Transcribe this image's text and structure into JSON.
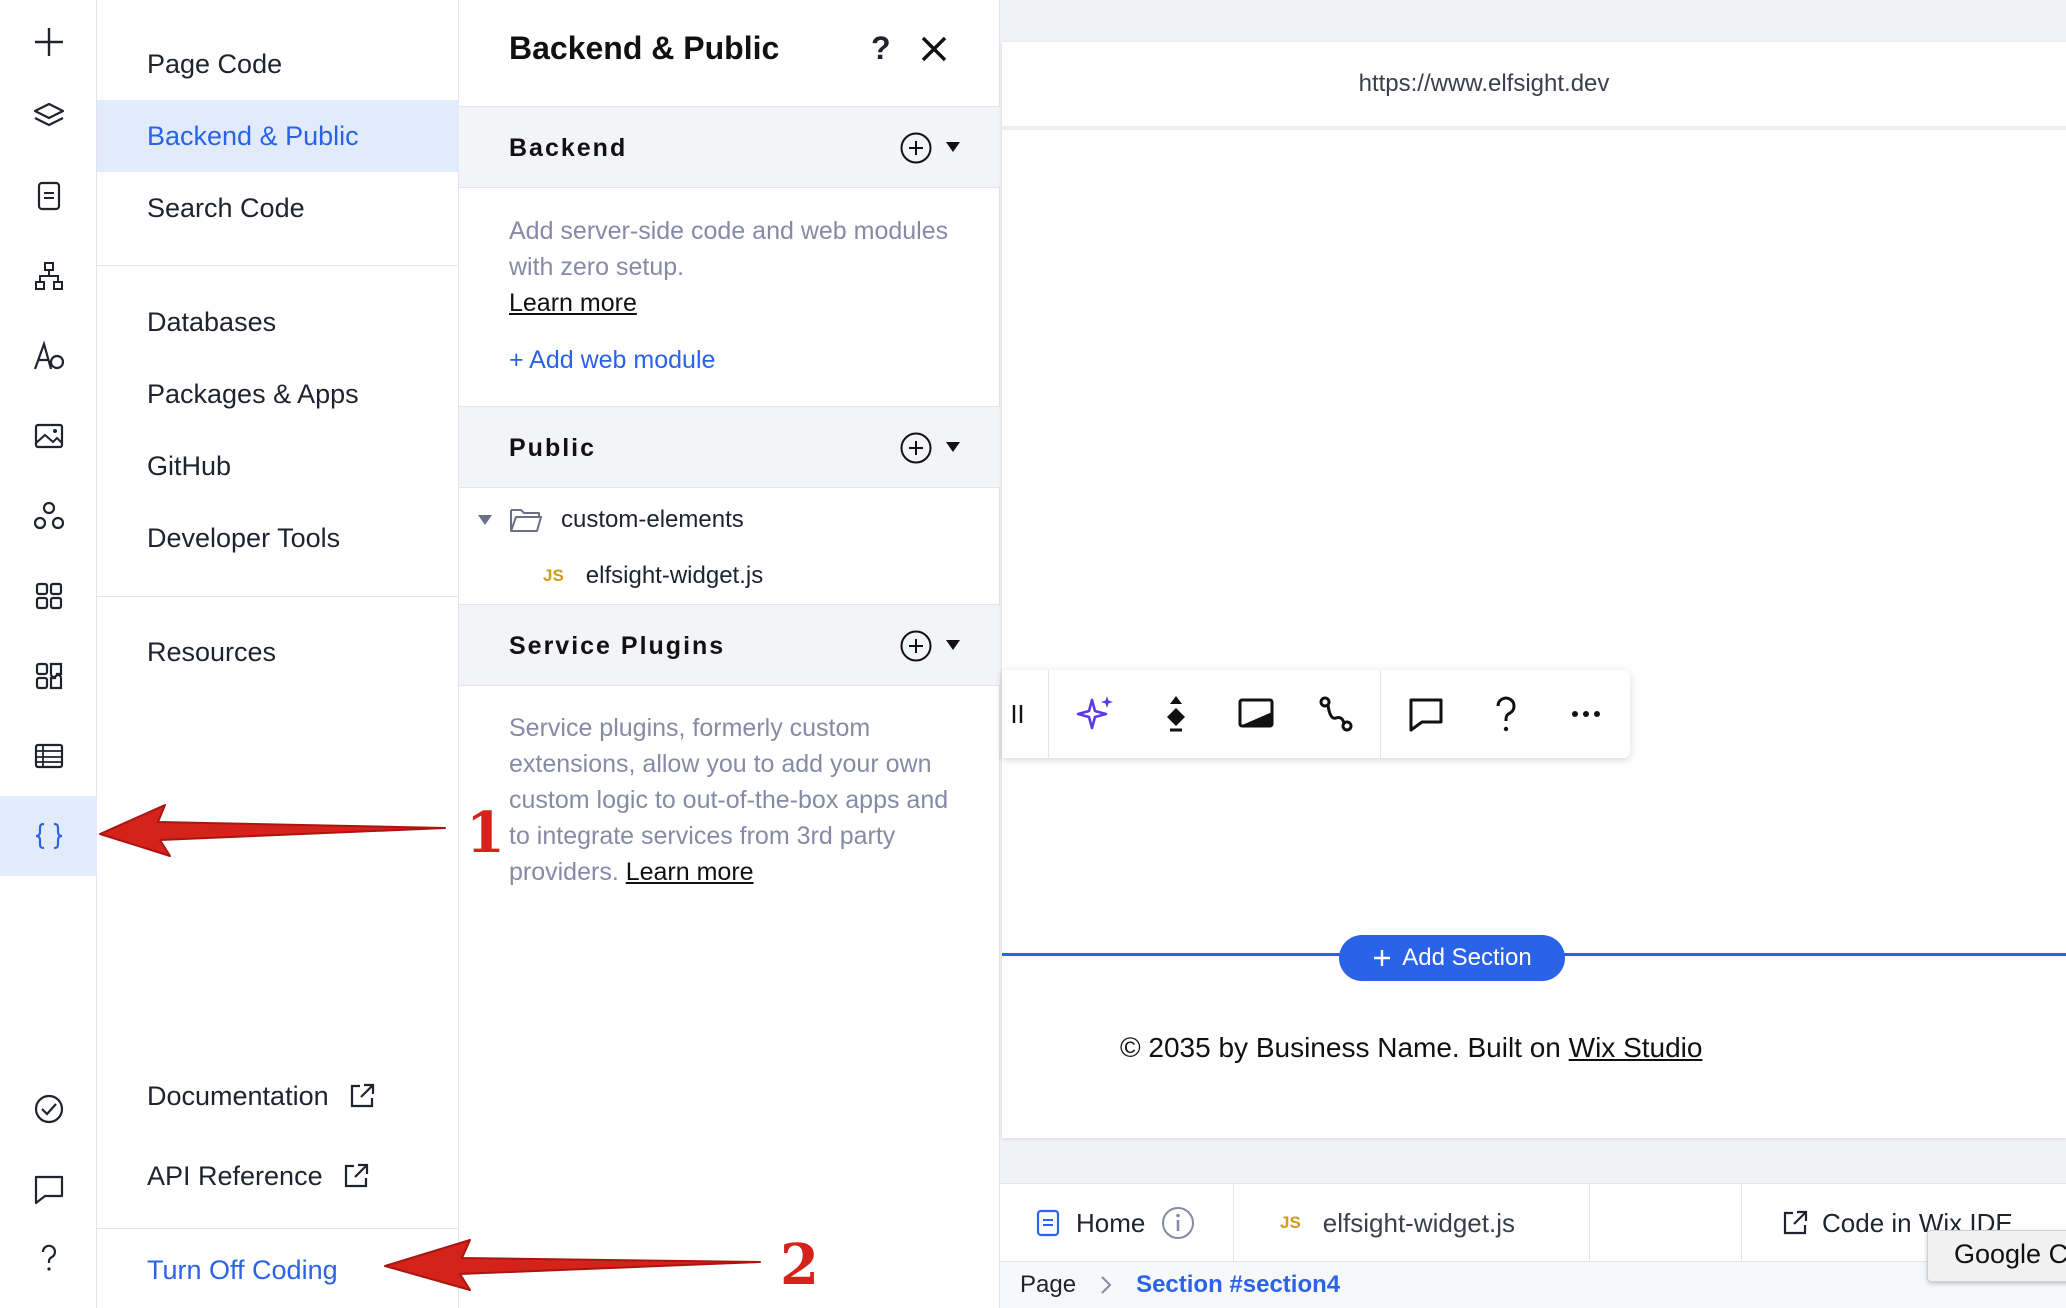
{
  "rail": {
    "icons": [
      "add-icon",
      "layers-icon",
      "page-icon",
      "sitemap-icon",
      "theme-icon",
      "media-icon",
      "apps-market-icon",
      "apps-grid-icon",
      "puzzle-icon",
      "table-icon",
      "code-braces-icon",
      "checklist-icon",
      "chat-icon",
      "help-icon"
    ],
    "active": "code-braces-icon"
  },
  "menu": {
    "page_code": "Page Code",
    "backend_public": "Backend & Public",
    "search_code": "Search Code",
    "databases": "Databases",
    "packages_apps": "Packages & Apps",
    "github": "GitHub",
    "developer_tools": "Developer Tools",
    "resources": "Resources",
    "documentation": "Documentation",
    "api_reference": "API Reference",
    "turn_off_coding": "Turn Off Coding"
  },
  "panel": {
    "title": "Backend & Public",
    "help": "?",
    "backend": {
      "label": "Backend",
      "desc": "Add server-side code and web modules with zero setup.",
      "learn_more": "Learn more",
      "add_web_module": "+ Add web module"
    },
    "public": {
      "label": "Public",
      "folder": "custom-elements",
      "file_badge": "JS",
      "file": "elfsight-widget.js"
    },
    "service_plugins": {
      "label": "Service Plugins",
      "desc": "Service plugins, formerly custom extensions, allow you to add your own custom logic to out-of-the-box apps and to integrate services from 3rd party providers.",
      "learn_more": "Learn more"
    }
  },
  "canvas": {
    "url": "https://www.elfsight.dev",
    "add_section": "Add Section",
    "footer_prefix": "© 2035 by Business Name. Built on",
    "footer_link": "Wix Studio"
  },
  "bottom": {
    "home_tab": "Home",
    "file_badge": "JS",
    "file_tab": "elfsight-widget.js",
    "code_in_ide": "Code in Wix IDE",
    "breadcrumb_page": "Page",
    "breadcrumb_section": "Section #section4",
    "tooltip": "Google Chrome"
  },
  "annotations": {
    "arrow1": "1",
    "arrow2": "2"
  },
  "colors": {
    "accent": "#2a63e8",
    "active_bg": "#e2ebfc",
    "annotation_red": "#d5231c",
    "js_badge": "#d19a1b"
  }
}
